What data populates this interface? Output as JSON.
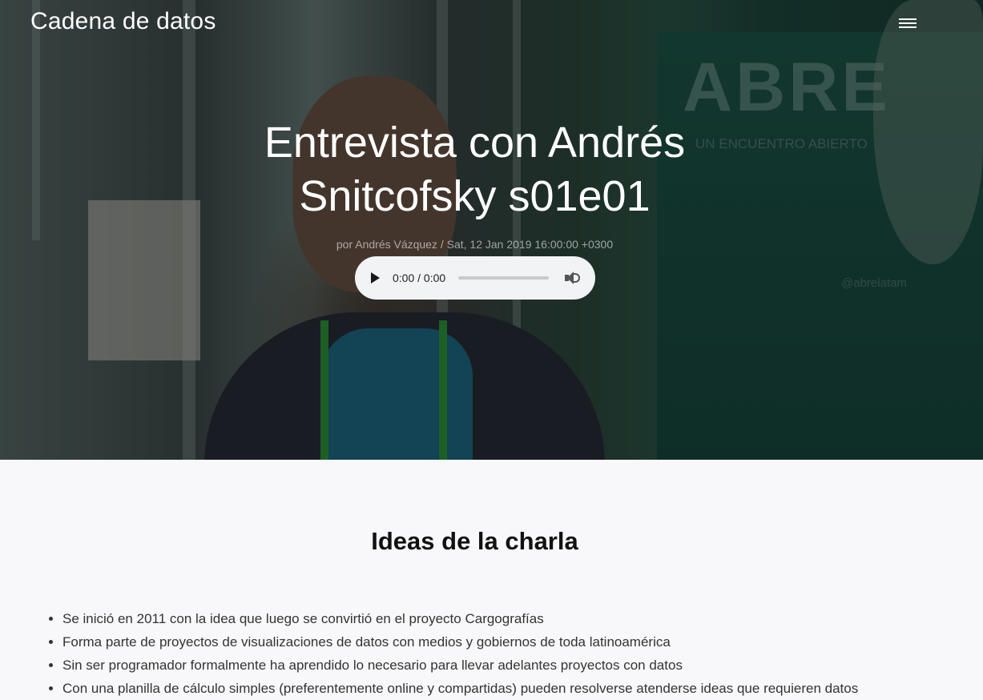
{
  "header": {
    "site_title": "Cadena de datos",
    "menu_icon": "hamburger-menu-icon"
  },
  "post": {
    "title_line1": "Entrevista con Andrés",
    "title_line2": "Snitcofsky s01e01",
    "meta": "por Andrés Vázquez / Sat, 12 Jan 2019 16:00:00 +0300"
  },
  "audio": {
    "time": "0:00 / 0:00",
    "play_icon": "play-icon",
    "volume_icon": "volume-icon",
    "progress": 0
  },
  "content": {
    "heading": "Ideas de la charla",
    "ideas": [
      "Se inició en 2011 con la idea que luego se convirtió en el proyecto Cargografías",
      "Forma parte de proyectos de visualizaciones de datos con medios y gobiernos de toda latinoamérica",
      "Sin ser programador formalmente ha aprendido lo necesario para llevar adelantes proyectos con datos",
      "Con una planilla de cálculo simples (preferentemente online y compartidas) pueden resolverse atenderse ideas que requieren datos"
    ]
  },
  "colors": {
    "hero_overlay": "#000000",
    "content_background": "#f8f8fa",
    "text_primary": "#111111",
    "player_background": "#f1f3f4"
  }
}
